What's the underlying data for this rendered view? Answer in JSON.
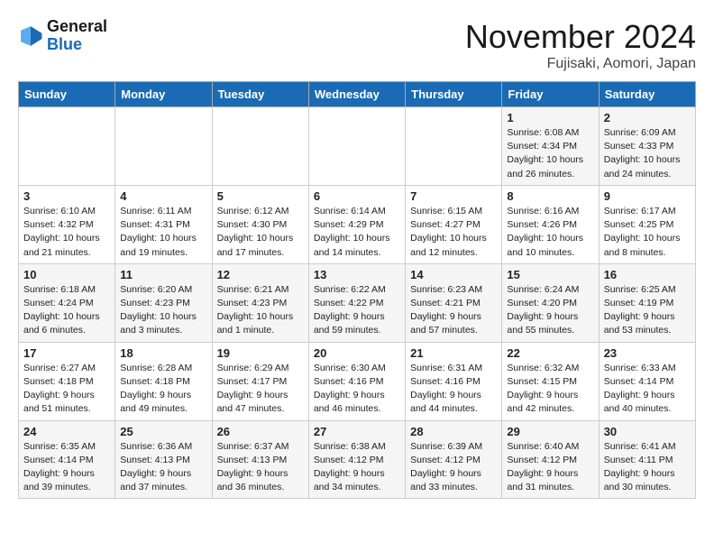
{
  "header": {
    "logo_line1": "General",
    "logo_line2": "Blue",
    "month": "November 2024",
    "location": "Fujisaki, Aomori, Japan"
  },
  "days_of_week": [
    "Sunday",
    "Monday",
    "Tuesday",
    "Wednesday",
    "Thursday",
    "Friday",
    "Saturday"
  ],
  "weeks": [
    [
      {
        "day": "",
        "info": ""
      },
      {
        "day": "",
        "info": ""
      },
      {
        "day": "",
        "info": ""
      },
      {
        "day": "",
        "info": ""
      },
      {
        "day": "",
        "info": ""
      },
      {
        "day": "1",
        "info": "Sunrise: 6:08 AM\nSunset: 4:34 PM\nDaylight: 10 hours and 26 minutes."
      },
      {
        "day": "2",
        "info": "Sunrise: 6:09 AM\nSunset: 4:33 PM\nDaylight: 10 hours and 24 minutes."
      }
    ],
    [
      {
        "day": "3",
        "info": "Sunrise: 6:10 AM\nSunset: 4:32 PM\nDaylight: 10 hours and 21 minutes."
      },
      {
        "day": "4",
        "info": "Sunrise: 6:11 AM\nSunset: 4:31 PM\nDaylight: 10 hours and 19 minutes."
      },
      {
        "day": "5",
        "info": "Sunrise: 6:12 AM\nSunset: 4:30 PM\nDaylight: 10 hours and 17 minutes."
      },
      {
        "day": "6",
        "info": "Sunrise: 6:14 AM\nSunset: 4:29 PM\nDaylight: 10 hours and 14 minutes."
      },
      {
        "day": "7",
        "info": "Sunrise: 6:15 AM\nSunset: 4:27 PM\nDaylight: 10 hours and 12 minutes."
      },
      {
        "day": "8",
        "info": "Sunrise: 6:16 AM\nSunset: 4:26 PM\nDaylight: 10 hours and 10 minutes."
      },
      {
        "day": "9",
        "info": "Sunrise: 6:17 AM\nSunset: 4:25 PM\nDaylight: 10 hours and 8 minutes."
      }
    ],
    [
      {
        "day": "10",
        "info": "Sunrise: 6:18 AM\nSunset: 4:24 PM\nDaylight: 10 hours and 6 minutes."
      },
      {
        "day": "11",
        "info": "Sunrise: 6:20 AM\nSunset: 4:23 PM\nDaylight: 10 hours and 3 minutes."
      },
      {
        "day": "12",
        "info": "Sunrise: 6:21 AM\nSunset: 4:23 PM\nDaylight: 10 hours and 1 minute."
      },
      {
        "day": "13",
        "info": "Sunrise: 6:22 AM\nSunset: 4:22 PM\nDaylight: 9 hours and 59 minutes."
      },
      {
        "day": "14",
        "info": "Sunrise: 6:23 AM\nSunset: 4:21 PM\nDaylight: 9 hours and 57 minutes."
      },
      {
        "day": "15",
        "info": "Sunrise: 6:24 AM\nSunset: 4:20 PM\nDaylight: 9 hours and 55 minutes."
      },
      {
        "day": "16",
        "info": "Sunrise: 6:25 AM\nSunset: 4:19 PM\nDaylight: 9 hours and 53 minutes."
      }
    ],
    [
      {
        "day": "17",
        "info": "Sunrise: 6:27 AM\nSunset: 4:18 PM\nDaylight: 9 hours and 51 minutes."
      },
      {
        "day": "18",
        "info": "Sunrise: 6:28 AM\nSunset: 4:18 PM\nDaylight: 9 hours and 49 minutes."
      },
      {
        "day": "19",
        "info": "Sunrise: 6:29 AM\nSunset: 4:17 PM\nDaylight: 9 hours and 47 minutes."
      },
      {
        "day": "20",
        "info": "Sunrise: 6:30 AM\nSunset: 4:16 PM\nDaylight: 9 hours and 46 minutes."
      },
      {
        "day": "21",
        "info": "Sunrise: 6:31 AM\nSunset: 4:16 PM\nDaylight: 9 hours and 44 minutes."
      },
      {
        "day": "22",
        "info": "Sunrise: 6:32 AM\nSunset: 4:15 PM\nDaylight: 9 hours and 42 minutes."
      },
      {
        "day": "23",
        "info": "Sunrise: 6:33 AM\nSunset: 4:14 PM\nDaylight: 9 hours and 40 minutes."
      }
    ],
    [
      {
        "day": "24",
        "info": "Sunrise: 6:35 AM\nSunset: 4:14 PM\nDaylight: 9 hours and 39 minutes."
      },
      {
        "day": "25",
        "info": "Sunrise: 6:36 AM\nSunset: 4:13 PM\nDaylight: 9 hours and 37 minutes."
      },
      {
        "day": "26",
        "info": "Sunrise: 6:37 AM\nSunset: 4:13 PM\nDaylight: 9 hours and 36 minutes."
      },
      {
        "day": "27",
        "info": "Sunrise: 6:38 AM\nSunset: 4:12 PM\nDaylight: 9 hours and 34 minutes."
      },
      {
        "day": "28",
        "info": "Sunrise: 6:39 AM\nSunset: 4:12 PM\nDaylight: 9 hours and 33 minutes."
      },
      {
        "day": "29",
        "info": "Sunrise: 6:40 AM\nSunset: 4:12 PM\nDaylight: 9 hours and 31 minutes."
      },
      {
        "day": "30",
        "info": "Sunrise: 6:41 AM\nSunset: 4:11 PM\nDaylight: 9 hours and 30 minutes."
      }
    ]
  ]
}
